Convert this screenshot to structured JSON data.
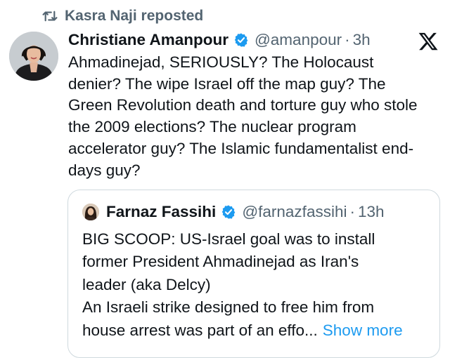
{
  "repost": {
    "text": "Kasra Naji reposted",
    "icon": "repost-icon"
  },
  "tweet": {
    "author_name": "Christiane Amanpour",
    "handle": "@amanpour",
    "separator": "·",
    "time": "3h",
    "verified": true,
    "avatar_icon": "user-avatar",
    "text_lines": [
      "Ahmadinejad, SERIOUSLY? The Holocaust",
      "denier? The wipe Israel off the map guy? The",
      "Green Revolution death and torture guy who stole",
      "the 2009 elections? The nuclear program",
      "accelerator guy? The Islamic fundamentalist end-",
      "days guy?"
    ]
  },
  "quote": {
    "author_name": "Farnaz Fassihi",
    "handle": "@farnazfassihi",
    "separator": "·",
    "time": "13h",
    "verified": true,
    "avatar_icon": "user-avatar",
    "text_lines": [
      "BIG SCOOP: US-Israel goal was to install",
      "former President Ahmadinejad as Iran's",
      "leader (aka Delcy)",
      "An Israeli strike designed to free him from",
      "house arrest was part of an effo..."
    ],
    "show_more": "Show more"
  },
  "colors": {
    "text": "#0f1419",
    "secondary": "#536471",
    "verified": "#1d9bf0",
    "link": "#1d9bf0",
    "border": "#cfd9de"
  },
  "icons": {
    "verified": "verified-badge-icon",
    "platform": "x-logo-icon"
  }
}
